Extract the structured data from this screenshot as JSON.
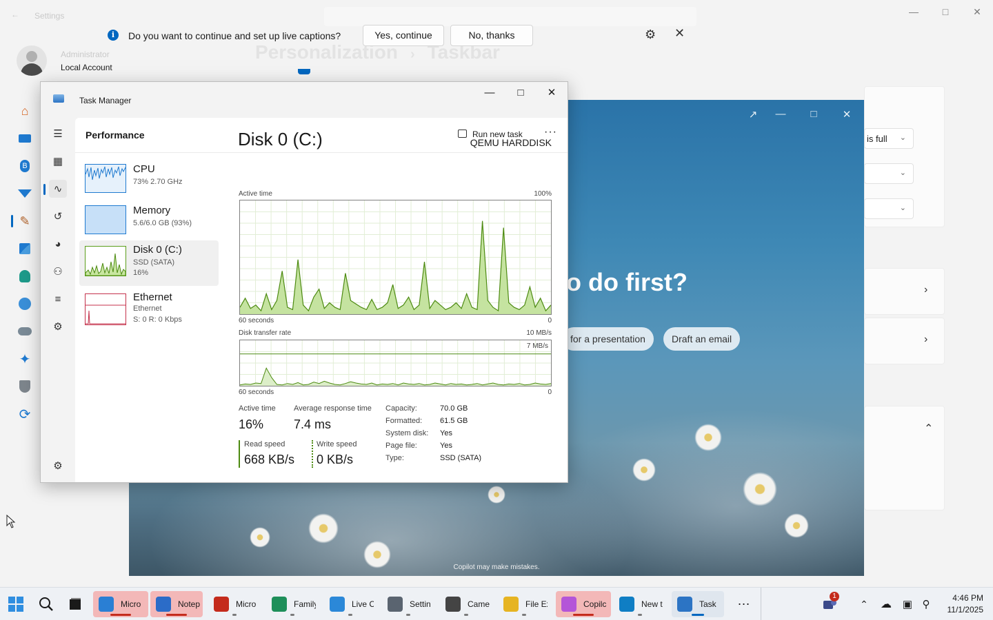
{
  "settings": {
    "title": "Settings",
    "user": {
      "name": "Administrator",
      "account_type": "Local Account"
    },
    "breadcrumb": {
      "parent": "Personalization",
      "current": "Taskbar"
    },
    "nav_icons": [
      "home-icon",
      "system-icon",
      "bluetooth-icon",
      "network-icon",
      "personalization-icon",
      "apps-icon",
      "accounts-icon",
      "time-language-icon",
      "gaming-icon",
      "accessibility-icon",
      "privacy-icon",
      "windows-update-icon"
    ],
    "dropdown_value": "is full"
  },
  "captions_banner": {
    "message": "Do you want to continue and set up live captions?",
    "yes_label": "Yes, continue",
    "no_label": "No, thanks"
  },
  "copilot": {
    "heading": "o do first?",
    "chips": [
      "for a presentation",
      "Draft an email"
    ],
    "disclaimer": "Copilot may make mistakes."
  },
  "task_manager": {
    "title": "Task Manager",
    "page_title": "Performance",
    "run_new_task": "Run new task",
    "more": "···",
    "sidebar": [
      {
        "name": "CPU",
        "line1": "73%  2.70 GHz",
        "line2": ""
      },
      {
        "name": "Memory",
        "line1": "5.6/6.0 GB (93%)",
        "line2": ""
      },
      {
        "name": "Disk 0 (C:)",
        "line1": "SSD (SATA)",
        "line2": "16%"
      },
      {
        "name": "Ethernet",
        "line1": "Ethernet",
        "line2": "S: 0  R: 0 Kbps"
      }
    ],
    "detail": {
      "title": "Disk 0 (C:)",
      "model": "QEMU HARDDISK",
      "chart1": {
        "label": "Active time",
        "max": "100%",
        "x_left": "60 seconds",
        "x_right": "0"
      },
      "chart2": {
        "label": "Disk transfer rate",
        "max": "10 MB/s",
        "marker": "7 MB/s",
        "x_left": "60 seconds",
        "x_right": "0"
      },
      "stats": {
        "active_time_label": "Active time",
        "active_time": "16%",
        "response_label": "Average response time",
        "response": "7.4 ms",
        "read_label": "Read speed",
        "read": "668 KB/s",
        "write_label": "Write speed",
        "write": "0 KB/s"
      },
      "properties": [
        {
          "label": "Capacity:",
          "value": "70.0 GB"
        },
        {
          "label": "Formatted:",
          "value": "61.5 GB"
        },
        {
          "label": "System disk:",
          "value": "Yes"
        },
        {
          "label": "Page file:",
          "value": "Yes"
        },
        {
          "label": "Type:",
          "value": "SSD (SATA)"
        }
      ]
    }
  },
  "chart_data": [
    {
      "type": "area",
      "title": "Active time",
      "ylim": [
        0,
        100
      ],
      "x_range_label": "60 seconds",
      "series": [
        {
          "values": [
            6,
            14,
            5,
            8,
            3,
            18,
            4,
            12,
            38,
            6,
            4,
            48,
            8,
            3,
            15,
            22,
            5,
            10,
            6,
            4,
            36,
            12,
            9,
            6,
            4,
            13,
            4,
            6,
            10,
            26,
            5,
            8,
            15,
            4,
            8,
            46,
            5,
            12,
            8,
            4,
            6,
            10,
            5,
            18,
            6,
            4,
            82,
            12,
            6,
            3,
            76,
            10,
            6,
            4,
            8,
            24,
            6,
            14,
            3,
            8
          ]
        }
      ]
    },
    {
      "type": "line",
      "title": "Disk transfer rate",
      "ylim": [
        0,
        10
      ],
      "unit": "MB/s",
      "series": [
        {
          "values": [
            0.2,
            0.4,
            0.3,
            0.6,
            0.5,
            3.9,
            1.8,
            0.3,
            0.2,
            0.5,
            0.3,
            0.7,
            0.2,
            0.3,
            0.8,
            0.5,
            1.0,
            0.6,
            0.3,
            0.2,
            0.5,
            0.9,
            0.6,
            0.4,
            0.3,
            0.6,
            0.2,
            0.4,
            0.3,
            0.5,
            0.2,
            0.6,
            0.4,
            0.3,
            0.5,
            0.2,
            0.3,
            0.6,
            0.4,
            0.2,
            0.5,
            0.3,
            0.4,
            0.2,
            0.3,
            0.5,
            0.2,
            0.4,
            0.6,
            0.3,
            0.2,
            0.4,
            0.3,
            0.5,
            0.2,
            0.3,
            0.6,
            0.4,
            0.3,
            0.5
          ]
        }
      ]
    }
  ],
  "taskbar": {
    "apps": [
      {
        "label": "Micro",
        "color": "#2a7fd4",
        "state": "active"
      },
      {
        "label": "Notep",
        "color": "#2b6cc8",
        "state": "active"
      },
      {
        "label": "Micro",
        "color": "#c42b1c",
        "state": "open"
      },
      {
        "label": "Family",
        "color": "#1e8f5a",
        "state": "open"
      },
      {
        "label": "Live C",
        "color": "#2b88d8",
        "state": "open"
      },
      {
        "label": "Settin",
        "color": "#5a6470",
        "state": "open"
      },
      {
        "label": "Came",
        "color": "#444444",
        "state": "open"
      },
      {
        "label": "File Ex",
        "color": "#e6b422",
        "state": "open"
      },
      {
        "label": "Copilc",
        "color": "#b455d8",
        "state": "active"
      },
      {
        "label": "New t",
        "color": "#0f7ec4",
        "state": "open"
      },
      {
        "label": "Task",
        "color": "#2c74c4",
        "state": "focused"
      }
    ],
    "notification_count": "1",
    "time": "4:46 PM",
    "date": "11/1/2025"
  }
}
